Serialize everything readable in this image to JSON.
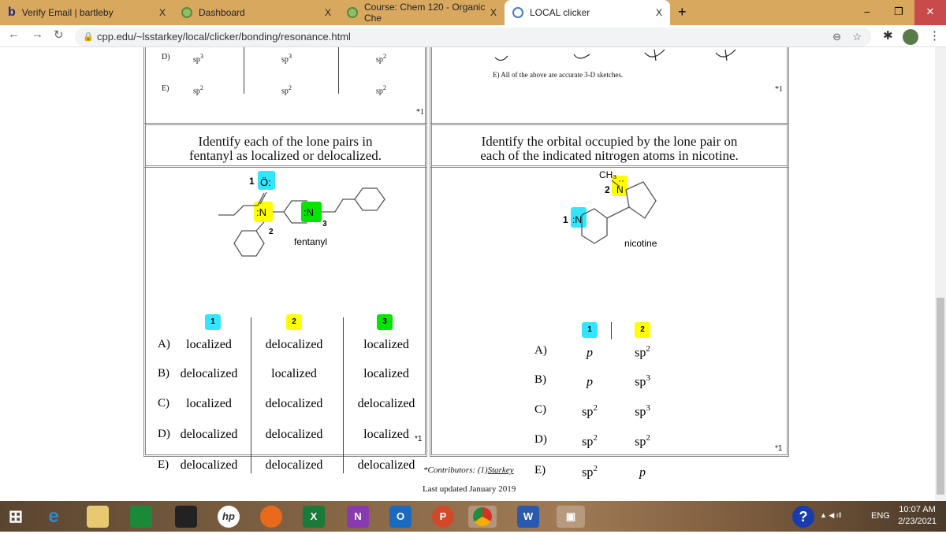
{
  "browser": {
    "tabs": [
      {
        "title": "Verify Email | bartleby",
        "close": "X"
      },
      {
        "title": "Dashboard",
        "close": "X"
      },
      {
        "title": "Course: Chem 120 - Organic Che",
        "close": "X"
      },
      {
        "title": "LOCAL clicker",
        "close": "X",
        "active": true
      }
    ],
    "new_tab": "+",
    "url": "cpp.edu/~lsstarkey/local/clicker/bonding/resonance.html",
    "controls": {
      "minimize": "–",
      "restore": "❐",
      "close": "✕"
    }
  },
  "top_left": {
    "rows": [
      {
        "letter": "D)",
        "c1": "sp",
        "c1s": "3",
        "c2": "sp",
        "c2s": "3",
        "c3": "sp",
        "c3s": "2"
      },
      {
        "letter": "E)",
        "c1": "sp",
        "c1s": "2",
        "c2": "sp",
        "c2s": "2",
        "c3": "sp",
        "c3s": "2"
      }
    ],
    "mark": "*1"
  },
  "top_right": {
    "option_e": "E) All of the above are accurate 3-D sketches.",
    "mark": "*1"
  },
  "fentanyl": {
    "title_l1": "Identify each of the lone pairs in",
    "title_l2": "fentanyl as localized or delocalized.",
    "molecule_label": "fentanyl",
    "atoms": {
      "o": "Ö:",
      "n2": ":N",
      "n3": ":N",
      "n1_num": "1",
      "n2_num": "2",
      "n3_num": "3"
    },
    "badges": [
      "1",
      "2",
      "3"
    ],
    "rows": [
      {
        "letter": "A)",
        "v": [
          "localized",
          "delocalized",
          "localized"
        ]
      },
      {
        "letter": "B)",
        "v": [
          "delocalized",
          "localized",
          "localized"
        ]
      },
      {
        "letter": "C)",
        "v": [
          "localized",
          "delocalized",
          "delocalized"
        ]
      },
      {
        "letter": "D)",
        "v": [
          "delocalized",
          "delocalized",
          "localized"
        ]
      },
      {
        "letter": "E)",
        "v": [
          "delocalized",
          "delocalized",
          "delocalized"
        ]
      }
    ],
    "mark": "*1"
  },
  "nicotine": {
    "title_l1": "Identify the orbital occupied by the lone pair on",
    "title_l2": "each of the indicated nitrogen atoms in nicotine.",
    "molecule_label": "nicotine",
    "atoms": {
      "ch3": "CH₃",
      "n1": ":N",
      "n2": "N",
      "n1_num": "1",
      "n2_num": "2"
    },
    "badges": [
      "1",
      "2"
    ],
    "rows": [
      {
        "letter": "A)",
        "a": "p",
        "as": "",
        "b": "sp",
        "bs": "2"
      },
      {
        "letter": "B)",
        "a": "p",
        "as": "",
        "b": "sp",
        "bs": "3"
      },
      {
        "letter": "C)",
        "a": "sp",
        "as": "2",
        "b": "sp",
        "bs": "3"
      },
      {
        "letter": "D)",
        "a": "sp",
        "as": "2",
        "b": "sp",
        "bs": "2"
      },
      {
        "letter": "E)",
        "a": "sp",
        "as": "2",
        "b": "p",
        "bs": ""
      }
    ],
    "mark": "*1"
  },
  "footer": {
    "contributors": "*Contributors: (1)",
    "contributor_link": "Starkey",
    "updated": "Last updated January 2019"
  },
  "taskbar": {
    "time": "10:07 AM",
    "date": "2/23/2021",
    "lang": "ENG"
  },
  "colors": {
    "cyan": "#33e6ff",
    "yellow": "#ffff00",
    "green": "#00e600",
    "tabbar": "#d9a85f"
  }
}
